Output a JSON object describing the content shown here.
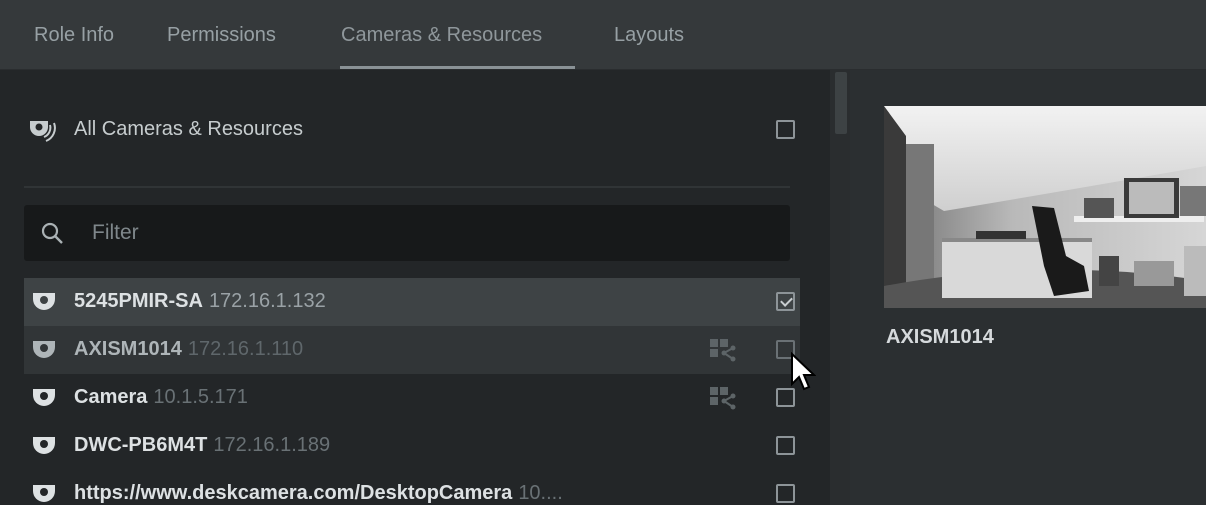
{
  "tabs": [
    {
      "label": "Role Info"
    },
    {
      "label": "Permissions"
    },
    {
      "label": "Cameras & Resources"
    },
    {
      "label": "Layouts"
    }
  ],
  "all_resources": {
    "label": "All Cameras & Resources",
    "checked": false
  },
  "filter": {
    "placeholder": "Filter",
    "value": ""
  },
  "cameras": [
    {
      "name": "5245PMIR-SA",
      "ip": "172.16.1.132",
      "checked": true,
      "shared": false
    },
    {
      "name": "AXISM1014",
      "ip": "172.16.1.110",
      "checked": false,
      "shared": true
    },
    {
      "name": "Camera",
      "ip": "10.1.5.171",
      "checked": false,
      "shared": true
    },
    {
      "name": "DWC-PB6M4T",
      "ip": "172.16.1.189",
      "checked": false,
      "shared": false
    },
    {
      "name": "https://www.deskcamera.com/DesktopCamera",
      "ip": "10....",
      "checked": false,
      "shared": false
    }
  ],
  "preview": {
    "caption": "AXISM1014"
  },
  "colors": {
    "accent": "#8a9296",
    "background": "#222527",
    "tabbar": "#35393b"
  }
}
